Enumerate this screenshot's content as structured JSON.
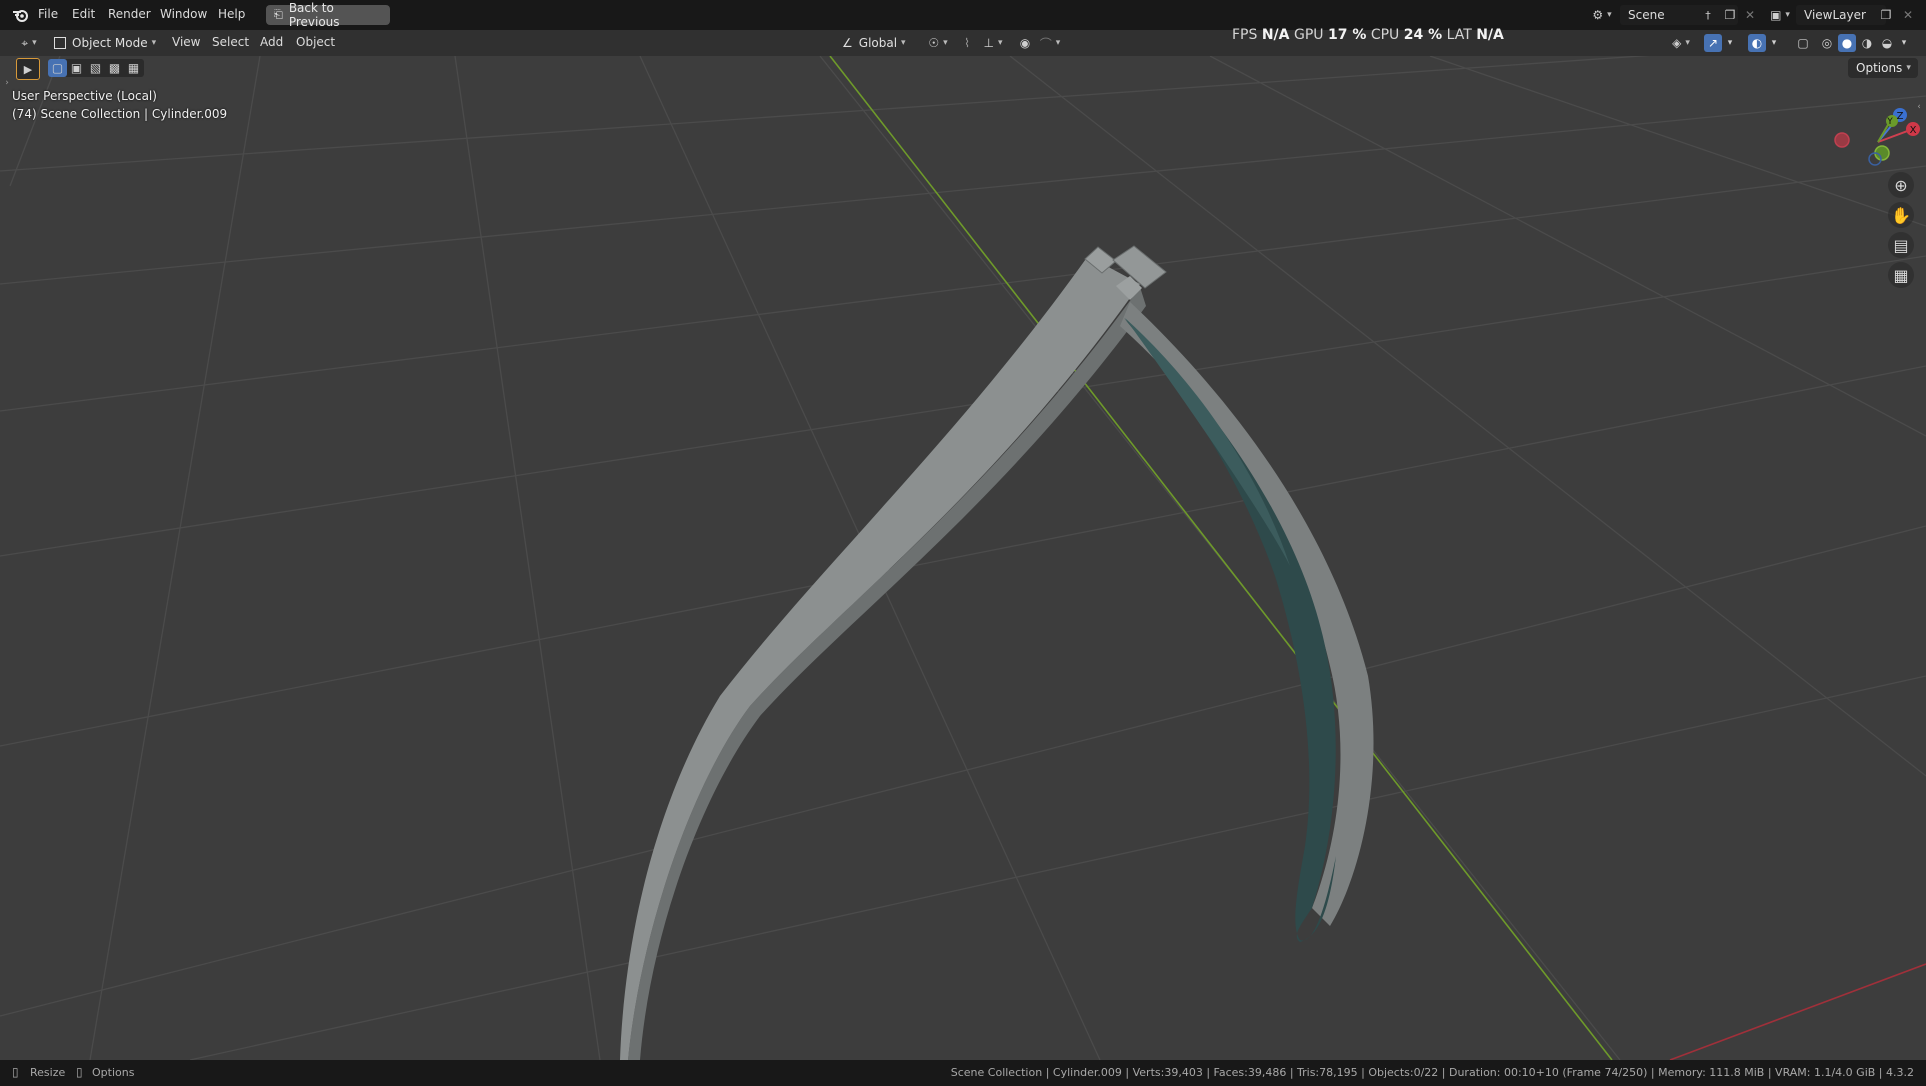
{
  "topbar": {
    "menus": [
      "File",
      "Edit",
      "Render",
      "Window",
      "Help"
    ],
    "back_button": "Back to Previous",
    "scene_field": "Scene",
    "viewlayer_field": "ViewLayer"
  },
  "header": {
    "mode": "Object Mode",
    "menus": [
      "View",
      "Select",
      "Add",
      "Object"
    ],
    "transform_orientation": "Global",
    "options": "Options"
  },
  "perf": {
    "fps_label": "FPS",
    "fps_value": "N/A",
    "gpu_label": "GPU",
    "gpu_value": "17 %",
    "cpu_label": "CPU",
    "cpu_value": "24 %",
    "lat_label": "LAT",
    "lat_value": "N/A"
  },
  "viewport": {
    "perspective_label": "User Perspective (Local)",
    "collection_label": "(74) Scene Collection | Cylinder.009"
  },
  "gizmo": {
    "x_label": "X",
    "y_label": "Y",
    "z_label": "Z"
  },
  "status": {
    "resize": "Resize",
    "options": "Options",
    "info": "Scene Collection | Cylinder.009 | Verts:39,403 | Faces:39,486 | Tris:78,195 | Objects:0/22 | Duration: 00:10+10 (Frame 74/250) | Memory: 111.8 MiB | VRAM: 1.1/4.0 GiB | 4.3.2"
  },
  "colors": {
    "background": "#3d3d3d",
    "grid": "#4a4a4a",
    "y_axis_line": "#6e9a2a",
    "x_axis_line": "#a0303a",
    "mesh": "#8a8e8e",
    "accent": "#4772b3"
  },
  "icons": {
    "app": "blender-logo-icon",
    "editor": "3d-viewport-icon",
    "zoom": "zoom-icon",
    "pan": "hand-icon",
    "camera": "camera-icon",
    "ortho": "grid-icon"
  }
}
